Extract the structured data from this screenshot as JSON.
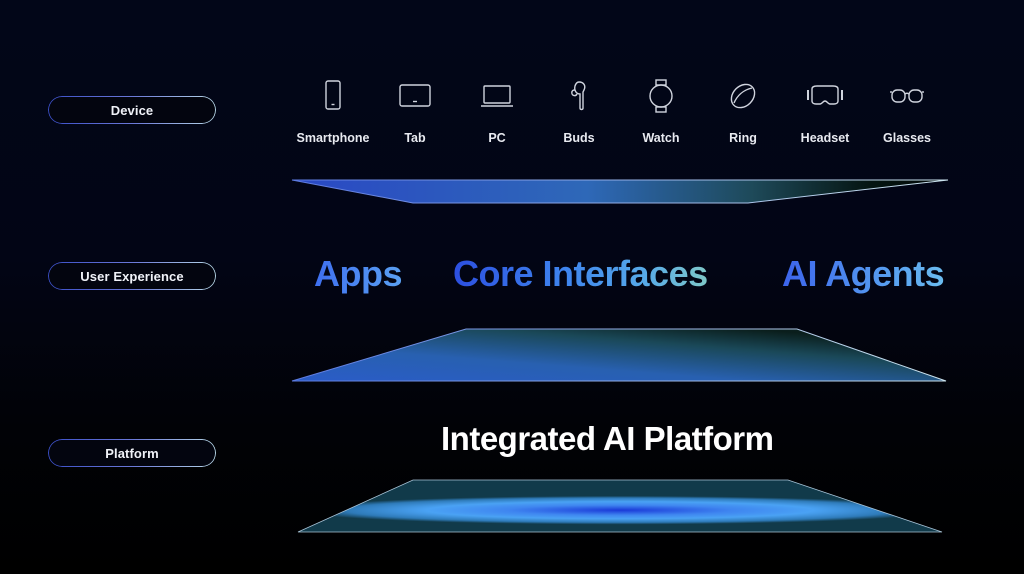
{
  "layers": {
    "device": "Device",
    "user_experience": "User Experience",
    "platform": "Platform"
  },
  "devices": [
    {
      "label": "Smartphone",
      "icon": "smartphone-icon"
    },
    {
      "label": "Tab",
      "icon": "tablet-icon"
    },
    {
      "label": "PC",
      "icon": "laptop-icon"
    },
    {
      "label": "Buds",
      "icon": "earbuds-icon"
    },
    {
      "label": "Watch",
      "icon": "watch-icon"
    },
    {
      "label": "Ring",
      "icon": "ring-icon"
    },
    {
      "label": "Headset",
      "icon": "headset-icon"
    },
    {
      "label": "Glasses",
      "icon": "glasses-icon"
    }
  ],
  "user_experience": {
    "items": [
      "Apps",
      "Core Interfaces",
      "AI Agents"
    ]
  },
  "platform": {
    "title": "Integrated AI Platform"
  },
  "colors": {
    "background": "#020618",
    "accent_blue": "#3e6ff0",
    "accent_teal": "#7fc8c8",
    "platform_glow": "#4aa0f8"
  }
}
